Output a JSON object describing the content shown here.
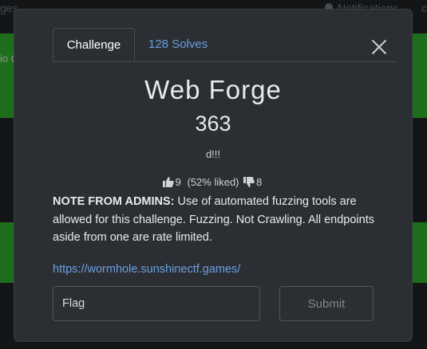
{
  "background": {
    "topbar_left_text": "ges",
    "notifications_label": "Notifications",
    "topbar_right_text": "c",
    "side_text": "io C",
    "accent_green": "#2fa82b"
  },
  "modal": {
    "tabs": [
      {
        "label": "Challenge",
        "active": true
      },
      {
        "label": "128 Solves",
        "active": false
      }
    ],
    "title": "Web Forge",
    "points": "363",
    "description": "d!!!",
    "votes": {
      "likes": "9",
      "liked_text": "(52% liked)",
      "dislikes": "8"
    },
    "note": {
      "prefix": "NOTE FROM ADMINS:",
      "body": " Use of automated fuzzing tools are allowed for this challenge. Fuzzing. Not Crawling. All endpoints aside from one are rate limited."
    },
    "link": "https://wormhole.sunshinectf.games/",
    "flag_placeholder": "Flag",
    "submit_label": "Submit"
  }
}
